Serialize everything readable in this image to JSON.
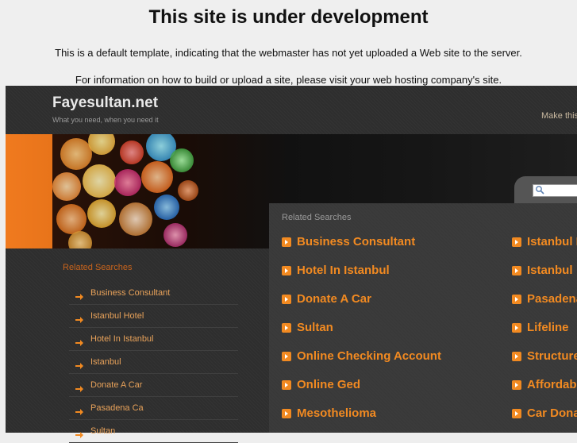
{
  "notice": {
    "heading": "This site is under development",
    "line1": "This is a default template, indicating that the webmaster has not yet uploaded a Web site to the server.",
    "line2": "For information on how to build or upload a site, please visit your web hosting company's site."
  },
  "header": {
    "site_name": "Fayesultan.net",
    "tagline": "What you need, when you need it",
    "make_link": "Make this"
  },
  "search": {
    "placeholder": ""
  },
  "main_panel": {
    "title": "Related Searches",
    "left_links": [
      "Business Consultant",
      "Hotel In Istanbul",
      "Donate A Car",
      "Sultan",
      "Online Checking Account",
      "Online Ged",
      "Mesothelioma"
    ],
    "right_links": [
      "Istanbul H",
      "Istanbul",
      "Pasadena",
      "Lifeline",
      "Structure",
      "Affordabl",
      "Car Dona"
    ]
  },
  "side_panel": {
    "title": "Related Searches",
    "items": [
      "Business Consultant",
      "Istanbul Hotel",
      "Hotel In Istanbul",
      "Istanbul",
      "Donate A Car",
      "Pasadena Ca",
      "Sultan"
    ]
  },
  "colors": {
    "accent_orange": "#f28a21",
    "page_bg": "#2e2e2e",
    "notice_bg": "#efefef"
  }
}
